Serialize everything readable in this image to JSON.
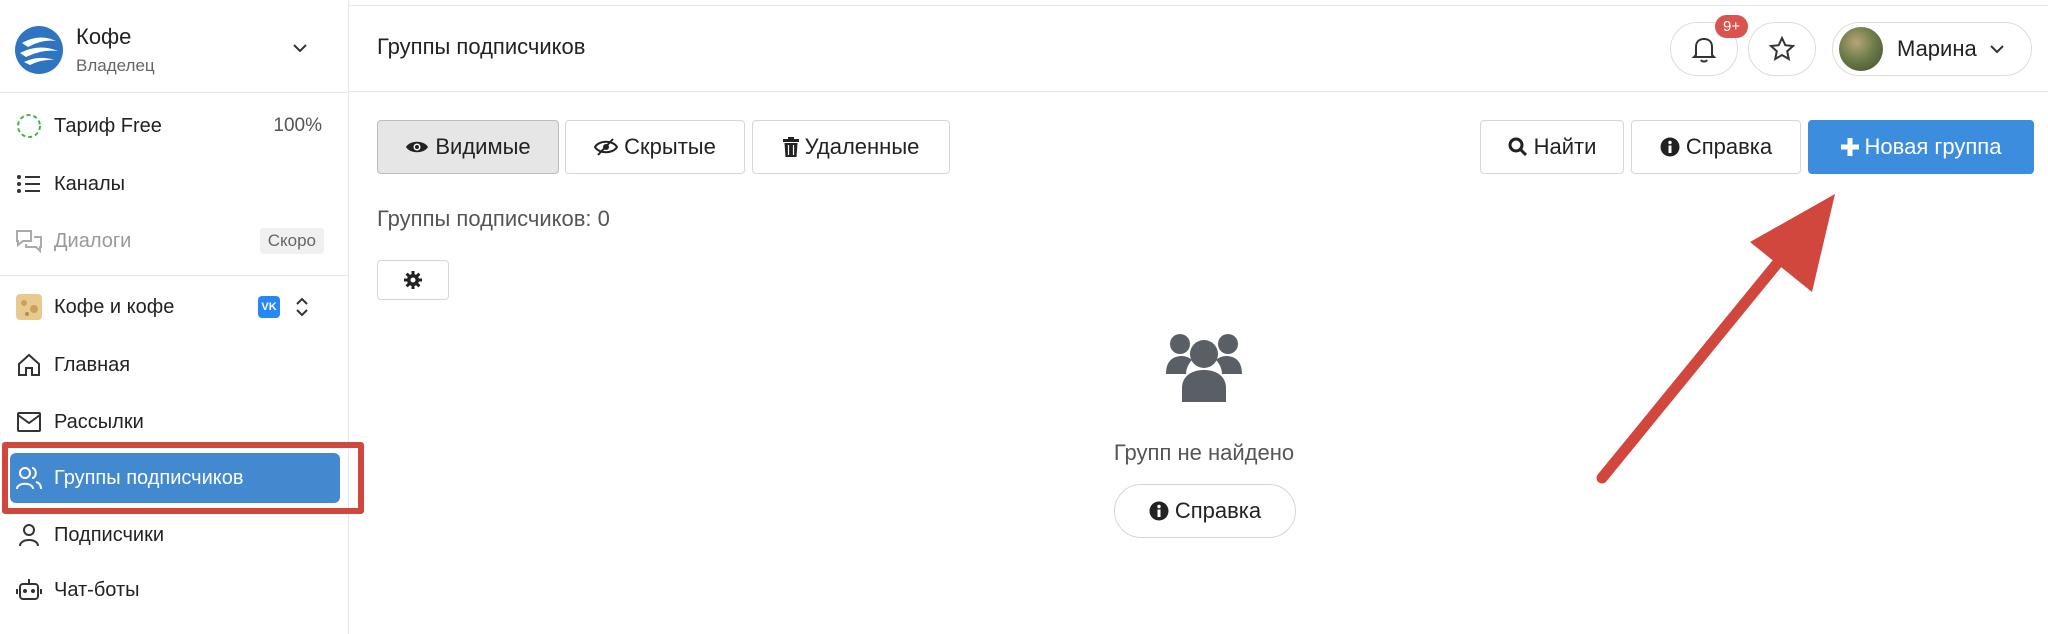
{
  "workspace": {
    "name": "Кофе",
    "role": "Владелец"
  },
  "sidebar": {
    "plan": {
      "label": "Тариф Free",
      "value": "100%"
    },
    "channels": {
      "label": "Каналы"
    },
    "dialogs": {
      "label": "Диалоги",
      "badge": "Скоро"
    },
    "project": {
      "label": "Кофе и кофе",
      "network_badge": "VK"
    },
    "items": [
      {
        "label": "Главная",
        "icon": "home-icon"
      },
      {
        "label": "Рассылки",
        "icon": "mail-icon"
      },
      {
        "label": "Группы подписчиков",
        "icon": "users-icon",
        "active": true
      },
      {
        "label": "Подписчики",
        "icon": "user-icon"
      },
      {
        "label": "Чат-боты",
        "icon": "bot-icon"
      }
    ]
  },
  "header": {
    "title": "Группы подписчиков",
    "notifications_badge": "9+",
    "user_name": "Марина"
  },
  "toolbar": {
    "tab_visible": "Видимые",
    "tab_hidden": "Скрытые",
    "tab_deleted": "Удаленные",
    "find_label": "Найти",
    "help_label": "Справка",
    "new_group_label": "Новая группа"
  },
  "content": {
    "count_label": "Группы подписчиков: 0",
    "empty_text": "Групп не найдено",
    "empty_help_label": "Справка"
  },
  "colors": {
    "accent": "#3c8dde",
    "active_nav": "#4389d0",
    "annotation": "#d2473d",
    "badge": "#d9534f"
  }
}
